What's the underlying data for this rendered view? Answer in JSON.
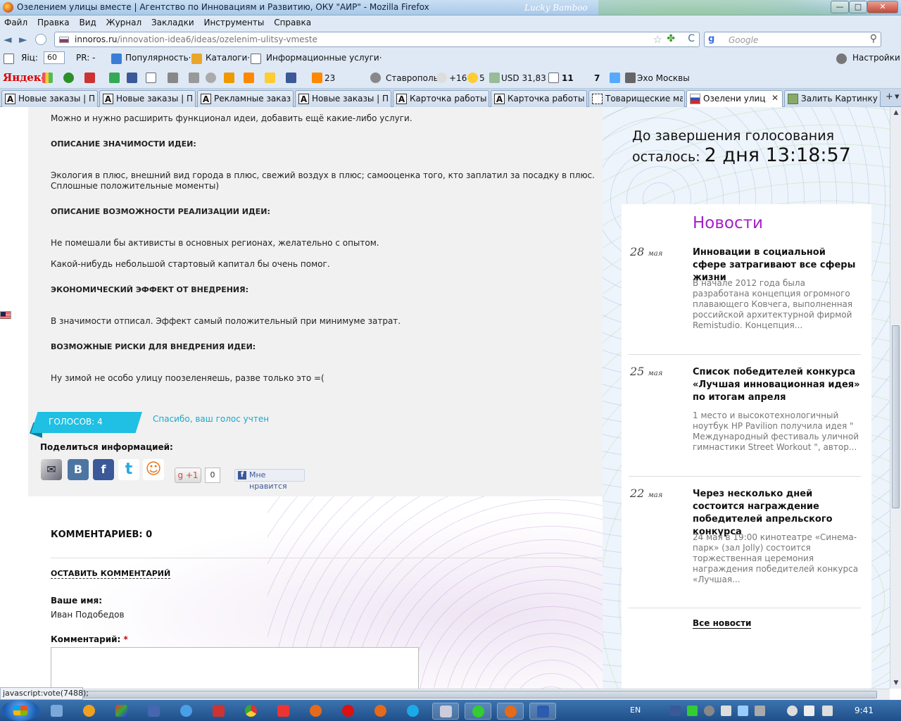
{
  "window": {
    "title": "Озелением улицы вместе | Агентство по Инновациям и Развитию, ОКУ \"АИР\" - Mozilla Firefox",
    "brand": "Lucky Bamboo",
    "min_glyph": "—",
    "max_glyph": "□",
    "close_glyph": "✕"
  },
  "menu": [
    "Файл",
    "Правка",
    "Вид",
    "Журнал",
    "Закладки",
    "Инструменты",
    "Справка"
  ],
  "nav": {
    "back_glyph": "◄",
    "forward_glyph": "►",
    "url_domain": "innoros.ru",
    "url_path": "/innovation-idea6/ideas/ozelenim-ulitsy-vmeste",
    "search_placeholder": "Google",
    "star_glyph": "☆",
    "clover_glyph": "✤",
    "reload_glyph": "C",
    "search_engine_glyph": "g",
    "search_glyph": "⚲"
  },
  "toolbar1": {
    "tic_label": "Яiц:",
    "tic_value": "60",
    "pr_label": "PR: -",
    "popularity": "Популярность·",
    "catalogs": "Каталоги·",
    "info_services": "Информационные услуги·",
    "settings": "Настройки·"
  },
  "toolbar2": {
    "yandex": "Яндекс",
    "mail_count": "23",
    "city": "Ставрополь",
    "temperature": "+16",
    "traffic": "5",
    "usd": "USD 31,83",
    "messages": "11",
    "at_count": "7",
    "radio": "Эхо Москвы"
  },
  "tabs": [
    {
      "label": "Новые заказы | П...",
      "icon": "A",
      "active": false
    },
    {
      "label": "Новые заказы | П...",
      "icon": "A",
      "active": false
    },
    {
      "label": "Рекламные заказ...",
      "icon": "A",
      "active": false
    },
    {
      "label": "Новые заказы | П...",
      "icon": "A",
      "active": false
    },
    {
      "label": "Карточка работы ...",
      "icon": "A",
      "active": false
    },
    {
      "label": "Карточка работы ...",
      "icon": "A",
      "active": false
    },
    {
      "label": "Товарищеские ма...",
      "icon": "",
      "active": false
    },
    {
      "label": "Озелени улиц...",
      "icon": "",
      "active": true
    },
    {
      "label": "Залить Картинку - ...",
      "icon": "",
      "active": false
    }
  ],
  "tab_close_glyph": "✕",
  "tab_controls": {
    "new_tab": "+",
    "list": "▾"
  },
  "idea": {
    "intro": "Можно и нужно расширить функционал идеи, добавить ещё какие-либо услуги.",
    "sig_heading": "ОПИСАНИЕ ЗНАЧИМОСТИ ИДЕИ:",
    "sig_text1": "Экология в плюс, внешний вид города в плюс, свежий воздух в плюс; самооценка того, кто заплатил за посадку в плюс.",
    "sig_text2": "Сплошные положительные моменты)",
    "impl_heading": "ОПИСАНИЕ ВОЗМОЖНОСТИ РЕАЛИЗАЦИИ ИДЕИ:",
    "impl_text1": "Не помешали бы активисты в основных регионах, желательно с опытом.",
    "impl_text2": "Какой-нибудь небольшой стартовый капитал бы очень помог.",
    "econ_heading": "ЭКОНОМИЧЕСКИЙ ЭФФЕКТ ОТ ВНЕДРЕНИЯ:",
    "econ_text": "В значимости отписал. Эффект самый положительный при минимуме затрат.",
    "risk_heading": "ВОЗМОЖНЫЕ РИСКИ ДЛЯ ВНЕДРЕНИЯ ИДЕИ:",
    "risk_text": "Ну зимой не особо улицу поозеленяешь, разве только это =(",
    "votes": "ГОЛОСОВ: 4",
    "thanks": "Спасибо, ваш голос учтен",
    "share_label": "Поделиться информацией:",
    "gplus": "g +1",
    "gplus_count": "0",
    "fb_like": "Мне нравится",
    "share_icons": {
      "bookmark": "✉",
      "vk": "В",
      "facebook": "f",
      "twitter": "t",
      "odnoklassniki": "☺"
    }
  },
  "comments": {
    "title": "КОММЕНТАРИЕВ: 0",
    "leave": "ОСТАВИТЬ КОММЕНТАРИЙ",
    "name_label": "Ваше имя:",
    "name_value": "Иван Подобедов",
    "comment_label": "Комментарий:",
    "required": "*"
  },
  "countdown": {
    "line1": "До завершения голосования",
    "line2": "осталось:",
    "value": "2 дня 13:18:57"
  },
  "news": {
    "title": "Новости",
    "items": [
      {
        "day": "28",
        "month": "мая",
        "headline": "Инновации в социальной сфере затрагивают все сферы жизни",
        "text": "В начале 2012 года была разработана концепция огромного плавающего Ковчега, выполненная российской архитектурной фирмой Remistudio. Концепция..."
      },
      {
        "day": "25",
        "month": "мая",
        "headline": "Список победителей конкурса «Лучшая инновационная идея» по итогам апреля",
        "text": "1 место и высокотехнологичный ноутбук HP Pavilion получила идея \" Международный фестиваль уличной гимнастики Street Workout \", автор..."
      },
      {
        "day": "22",
        "month": "мая",
        "headline": "Через несколько дней состоится награждение победителей апрельского конкурса",
        "text": "24 мая в 19:00 кинотеатре «Синема-парк» (зал Jolly) состоится торжественная церемония награждения победителей конкурса «Лучшая..."
      }
    ],
    "all_news": "Все новости"
  },
  "scroll": {
    "up_glyph": "▲",
    "down_glyph": "▼"
  },
  "status": "javascript:vote(7488);",
  "taskbar": {
    "lang": "EN",
    "time": "9:41"
  }
}
